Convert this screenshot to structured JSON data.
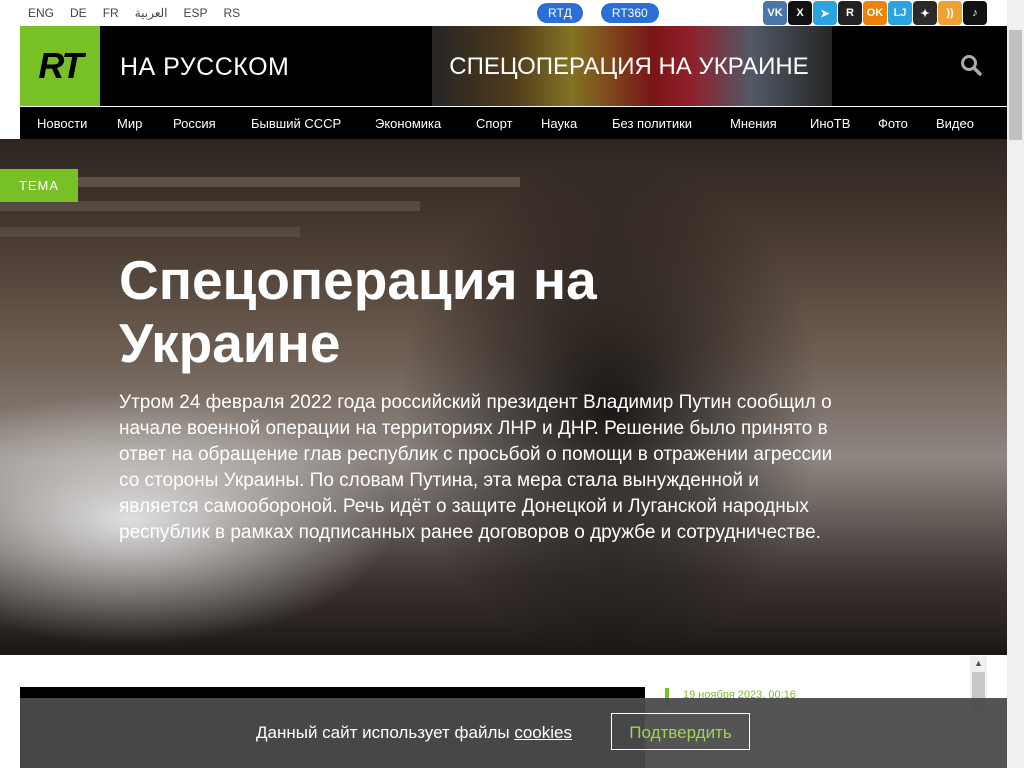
{
  "topbar": {
    "languages": [
      "ENG",
      "DE",
      "FR",
      "العربية",
      "ESP",
      "RS"
    ],
    "pills": [
      "RTД",
      "RT360"
    ],
    "socials": [
      {
        "name": "vk-icon",
        "label": "VK",
        "color": "#4a76a8"
      },
      {
        "name": "x-icon",
        "label": "X",
        "color": "#111111"
      },
      {
        "name": "telegram-icon",
        "label": "➤",
        "color": "#2aa3df"
      },
      {
        "name": "rutube-icon",
        "label": "R",
        "color": "#222222"
      },
      {
        "name": "ok-icon",
        "label": "OK",
        "color": "#ee8208"
      },
      {
        "name": "livejournal-icon",
        "label": "LJ",
        "color": "#2aa3df"
      },
      {
        "name": "zen-icon",
        "label": "✦",
        "color": "#2b2b2b"
      },
      {
        "name": "rss-icon",
        "label": "))",
        "color": "#f0a030"
      },
      {
        "name": "tiktok-icon",
        "label": "♪",
        "color": "#111111"
      }
    ]
  },
  "header": {
    "logo": "RT",
    "site_name": "НА РУССКОМ",
    "banner_title": "СПЕЦОПЕРАЦИЯ НА УКРАИНЕ"
  },
  "nav": {
    "items": [
      "Новости",
      "Мир",
      "Россия",
      "Бывший СССР",
      "Экономика",
      "Спорт",
      "Наука",
      "Без политики",
      "Мнения",
      "ИноТВ",
      "Фото",
      "Видео"
    ]
  },
  "hero": {
    "tag": "ТЕМА",
    "title": "Спецоперация на Украине",
    "text": "Утром 24 февраля 2022 года российский президент Владимир Путин сообщил о начале военной операции на территориях ЛНР и ДНР. Решение было принято в ответ на обращение глав республик с просьбой о помощи в отражении агрессии со стороны Украины. По словам Путина, эта мера стала вынужденной и является самообороной. Речь идёт о защите Донецкой и Луганской народных республик в рамках подписанных ранее договоров о дружбе и сотрудничестве."
  },
  "sidebar": {
    "date": "19 ноября 2023, 00:16"
  },
  "cookie": {
    "text": "Данный сайт использует файлы ",
    "link": "cookies",
    "button": "Подтвердить"
  },
  "colors": {
    "accent": "#77c127",
    "pill": "#2b6fd6"
  }
}
